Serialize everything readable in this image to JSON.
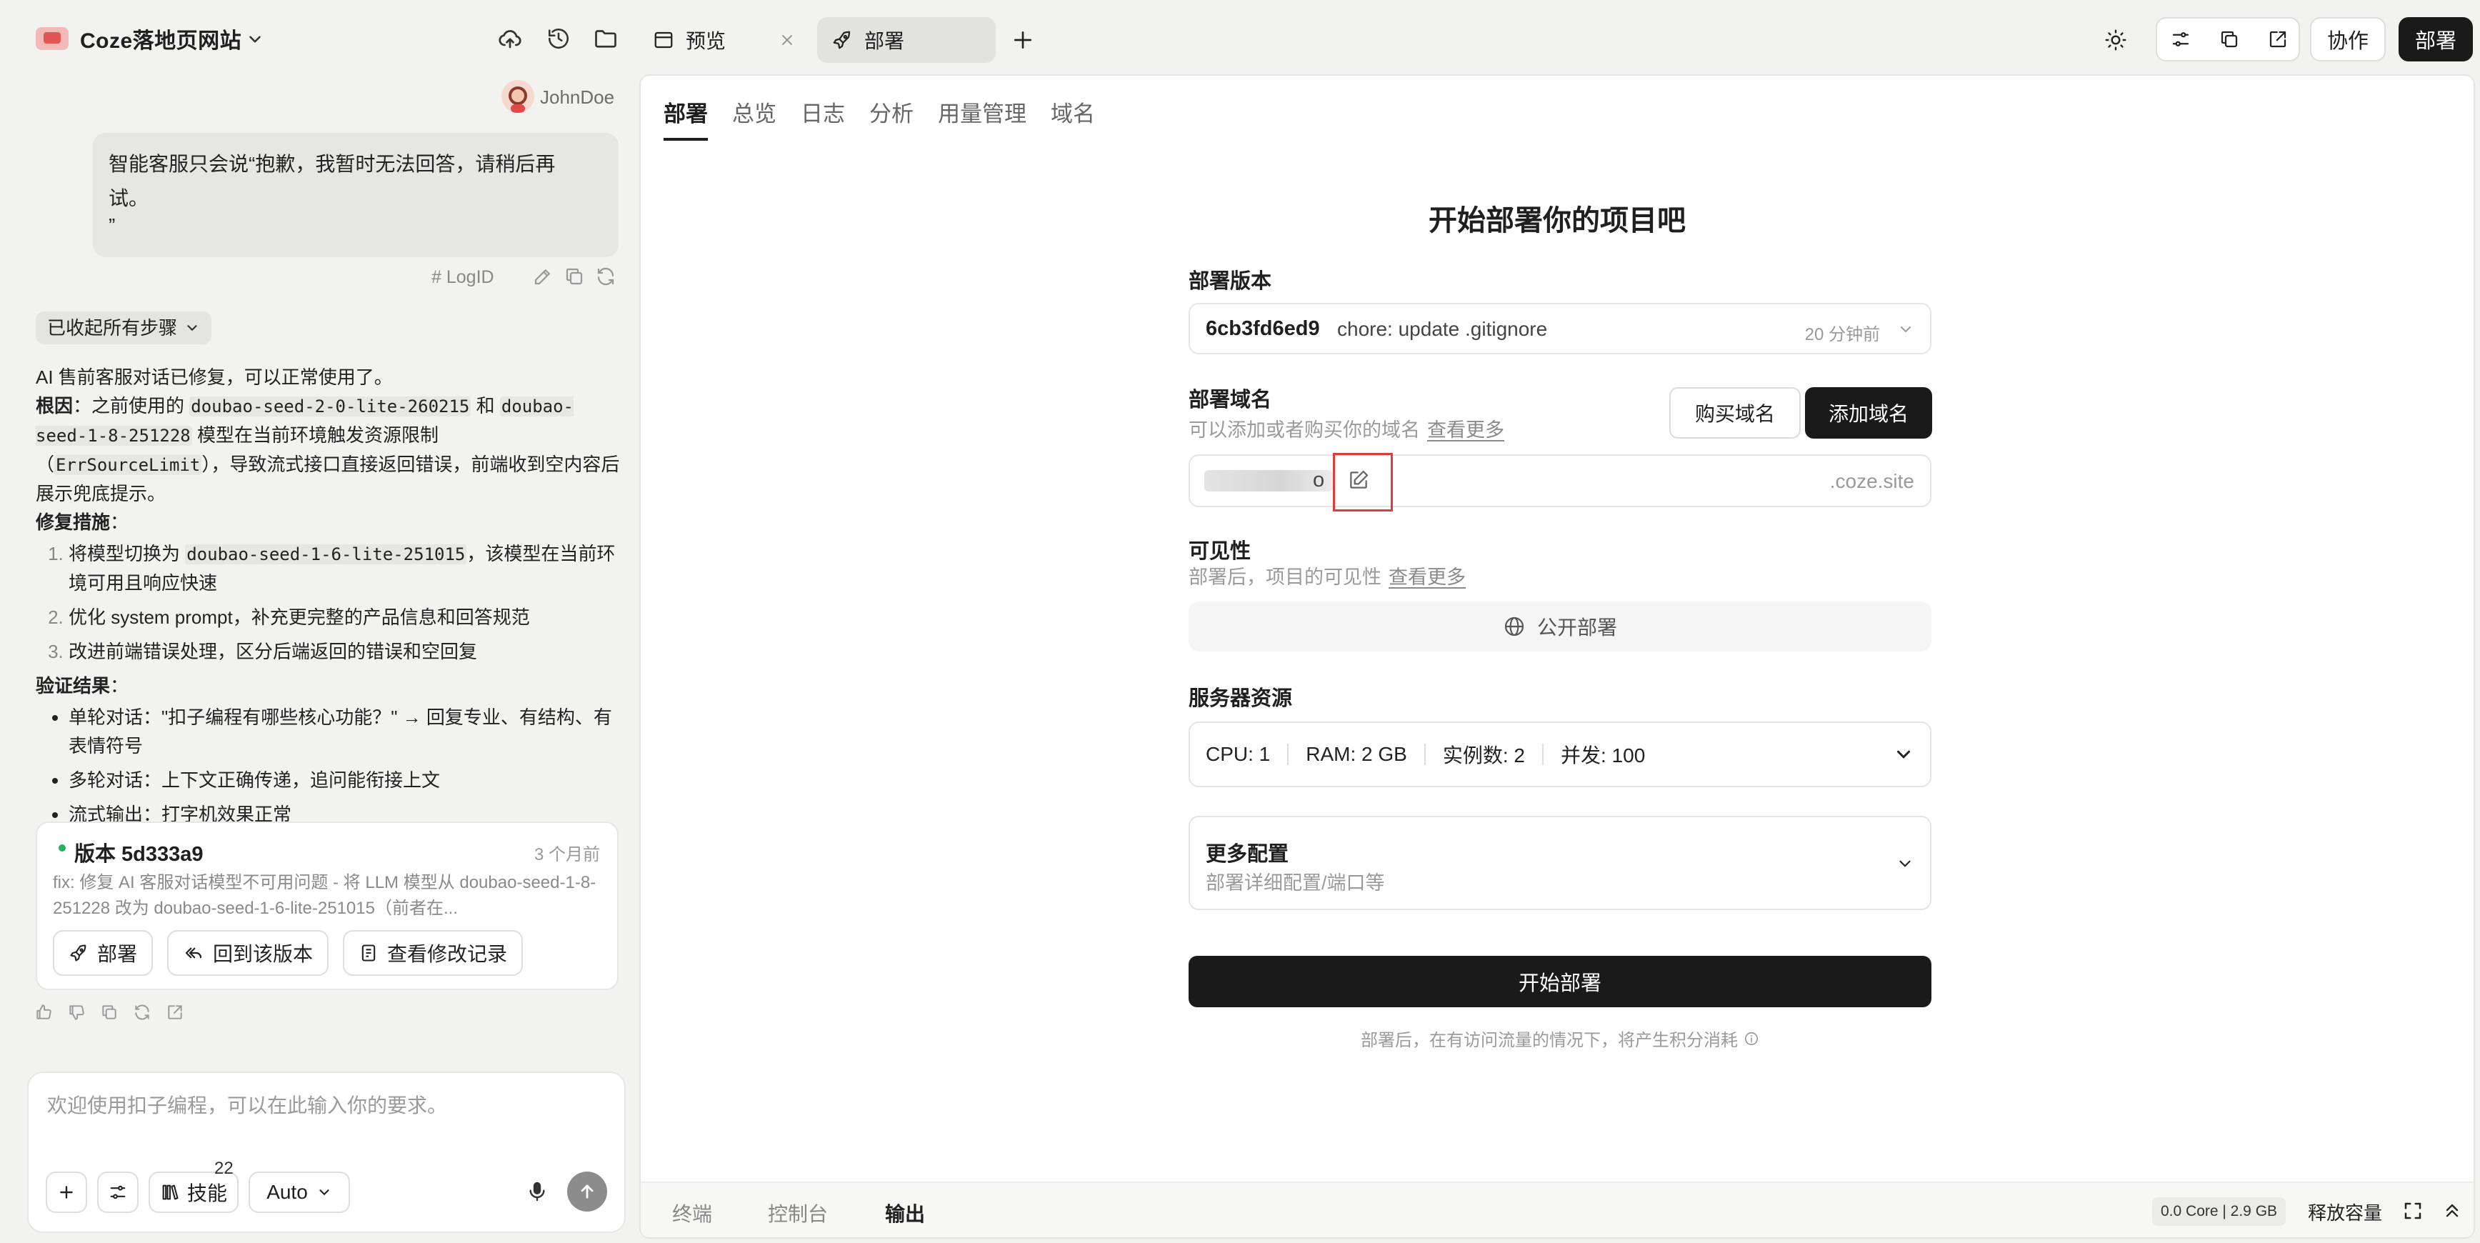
{
  "project": {
    "title": "Coze落地页网站"
  },
  "user": {
    "name": "JohnDoe"
  },
  "user_message": {
    "lines": [
      "智能客服只会说“抱歉，我暂时无法回答，请稍后再",
      "试。",
      "”"
    ],
    "logid_label": "LogID"
  },
  "collapse": {
    "label": "已收起所有步骤"
  },
  "answer": {
    "intro": "AI 售前客服对话已修复，可以正常使用了。",
    "cause_label": "根因",
    "cause_a": "：之前使用的 ",
    "model_old_1": "doubao-seed-2-0-lite-260215",
    "cause_b": " 和 ",
    "model_old_2": "doubao-seed-1-8-251228",
    "cause_c": " 模型在当前环境触发资源限制（",
    "error_code": "ErrSourceLimit",
    "cause_d": "），导致流式接口直接返回错误，前端收到空内容后展示兜底提示。",
    "fix_label": "修复措施",
    "colon": "：",
    "fix_1a": "将模型切换为 ",
    "model_new": "doubao-seed-1-6-lite-251015",
    "fix_1b": "，该模型在当前环境可用且响应快速",
    "fix_2": "优化 system prompt，补充更完整的产品信息和回答规范",
    "fix_3": "改进前端错误处理，区分后端返回的错误和空回复",
    "verify_label": "验证结果",
    "verify_1": "单轮对话：\"扣子编程有哪些核心功能？\" → 回复专业、有结构、有表情符号",
    "verify_2": "多轮对话：上下文正确传递，追问能衔接上文",
    "verify_3": "流式输出：打字机效果正常"
  },
  "version_card": {
    "title": "版本 5d333a9",
    "time": "3 个月前",
    "desc": "fix: 修复 AI 客服对话模型不可用问题 - 将 LLM 模型从 doubao-seed-1-8-251228 改为 doubao-seed-1-6-lite-251015（前者在...",
    "btn_deploy": "部署",
    "btn_revert": "回到该版本",
    "btn_history": "查看修改记录"
  },
  "composer": {
    "placeholder": "欢迎使用扣子编程，可以在此输入你的要求。",
    "skills_label": "技能",
    "skills_count": "22",
    "model_label": "Auto"
  },
  "tabs": [
    {
      "label": "预览"
    },
    {
      "label": "部署"
    }
  ],
  "topbar": {
    "collab_label": "协作",
    "deploy_label": "部署"
  },
  "subtabs": [
    "部署",
    "总览",
    "日志",
    "分析",
    "用量管理",
    "域名"
  ],
  "deploy": {
    "heading": "开始部署你的项目吧",
    "version_label": "部署版本",
    "commit_hash": "6cb3fd6ed9",
    "commit_msg": "chore: update .gitignore",
    "commit_time": "20 分钟前",
    "domain_label": "部署域名",
    "domain_sub": "可以添加或者购买你的域名",
    "learn_more": "查看更多",
    "buy_domain": "购买域名",
    "add_domain": "添加域名",
    "domain_partial": "o",
    "domain_suffix": ".coze.site",
    "visibility_label": "可见性",
    "visibility_sub": "部署后，项目的可见性",
    "visibility_value": "公开部署",
    "resources_label": "服务器资源",
    "cpu": "CPU: 1",
    "ram": "RAM: 2 GB",
    "instances": "实例数: 2",
    "concurrency": "并发: 100",
    "more_title": "更多配置",
    "more_sub": "部署详细配置/端口等",
    "start_button": "开始部署",
    "footnote": "部署后，在有访问流量的情况下，将产生积分消耗"
  },
  "bottom": {
    "terminal": "终端",
    "console": "控制台",
    "output": "输出",
    "capacity": "0.0 Core | 2.9 GB",
    "release": "释放容量"
  },
  "icons": {
    "project": "project-app-icon",
    "cloud": "cloud-upload-icon",
    "history": "history-icon",
    "folder": "folder-icon",
    "theme": "sun-icon",
    "globe": "globe-icon",
    "edit": "edit-pencil-icon"
  }
}
